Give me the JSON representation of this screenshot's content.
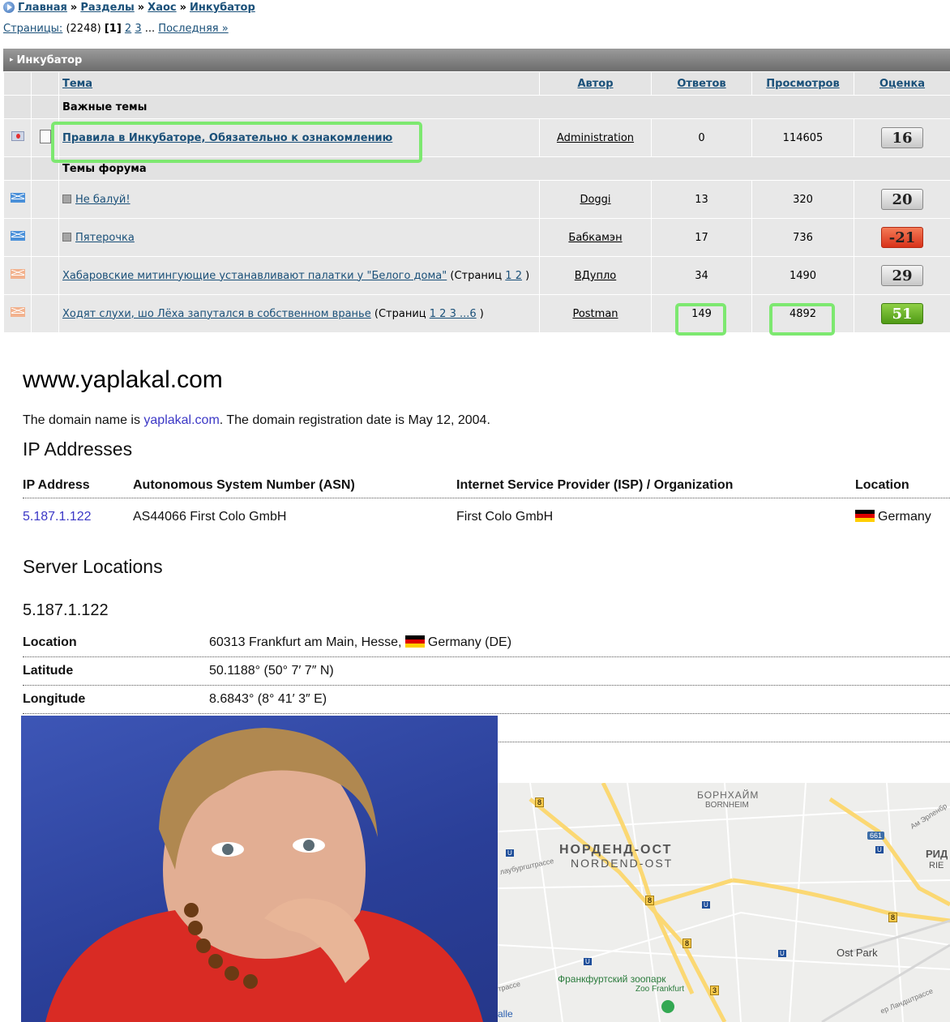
{
  "breadcrumb": {
    "items": [
      "Главная",
      "Разделы",
      "Хаос",
      "Инкубатор"
    ],
    "separator": "»"
  },
  "pagination": {
    "label": "Страницы:",
    "count": "(2248)",
    "current": "[1]",
    "pages": [
      "2",
      "3"
    ],
    "ellipsis": "...",
    "last": "Последняя »"
  },
  "forum": {
    "title": "Инкубатор",
    "columns": {
      "topic": "Тема",
      "author": "Автор",
      "replies": "Ответов",
      "views": "Просмотров",
      "rating": "Оценка"
    },
    "important_section": "Важные темы",
    "forum_section": "Темы форума",
    "pinned": {
      "title": "Правила в Инкубаторе, Обязательно к ознакомлению",
      "author": "Administration",
      "replies": "0",
      "views": "114605",
      "rating": "16"
    },
    "topics": [
      {
        "title": "Не балуй!",
        "author": "Doggi",
        "replies": "13",
        "views": "320",
        "rating": "20",
        "rating_color": "gray",
        "pages": ""
      },
      {
        "title": "Пятерочка",
        "author": "Бабкамэн",
        "replies": "17",
        "views": "736",
        "rating": "-21",
        "rating_color": "red",
        "pages": ""
      },
      {
        "title": "Хабаровские митингующие устанавливают палатки у \"Белого дома\"",
        "author": "ВДупло",
        "replies": "34",
        "views": "1490",
        "rating": "29",
        "rating_color": "gray",
        "pages_prefix": "(Страниц",
        "pages": "1 2",
        "pages_suffix": ")"
      },
      {
        "title": "Ходят слухи, шо Лёха запутался в собственном вранье",
        "author": "Postman",
        "replies": "149",
        "views": "4892",
        "rating": "51",
        "rating_color": "green",
        "pages_prefix": "(Страниц",
        "pages": "1 2 3 ...6",
        "pages_suffix": ")"
      }
    ]
  },
  "site": {
    "title": "www.yaplakal.com",
    "desc_prefix": "The domain name is ",
    "desc_link": "yaplakal.com",
    "desc_suffix": ". The domain registration date is May 12, 2004."
  },
  "ip_section": {
    "heading": "IP Addresses",
    "headers": [
      "IP Address",
      "Autonomous System Number (ASN)",
      "Internet Service Provider (ISP) / Organization",
      "Location"
    ],
    "row": {
      "ip": "5.187.1.122",
      "asn": "AS44066 First Colo GmbH",
      "isp": "First Colo GmbH",
      "location": "Germany"
    }
  },
  "server_section": {
    "heading": "Server Locations",
    "ip": "5.187.1.122",
    "rows": [
      {
        "key": "Location",
        "value_prefix": "60313 Frankfurt am Main, Hesse, ",
        "value_suffix": "Germany (DE)"
      },
      {
        "key": "Latitude",
        "value": "50.1188° (50° 7′ 7″ N)"
      },
      {
        "key": "Longitude",
        "value": "8.6843° (8° 41′ 3″ E)"
      }
    ]
  },
  "map": {
    "labels": {
      "bornheim_ru": "БОРНХАЙМ",
      "bornheim": "BORNHEIM",
      "nordend_ru": "НОРДЕНД-ОСТ",
      "nordend": "NORDEND-OST",
      "ostpark": "Ost Park",
      "zoo_ru": "Франкфуртский зоопарк",
      "zoo": "Zoo Frankfurt",
      "street1": "лаубургштрассе",
      "street2": "трассе",
      "street3": "Ам Эрленбр",
      "street4": "ер Ландштрассе",
      "edge_right": "РИД",
      "edge_right2": "RIE",
      "edge_left": "alle",
      "road_661": "661"
    },
    "road_badge": "8",
    "road_badge_3": "3",
    "metro": "U"
  },
  "colors": {
    "link": "#1a5079",
    "highlight": "#7de870",
    "rating_red": "#d8321a",
    "rating_green": "#4f9a16",
    "ip_link": "#3b37c6"
  }
}
